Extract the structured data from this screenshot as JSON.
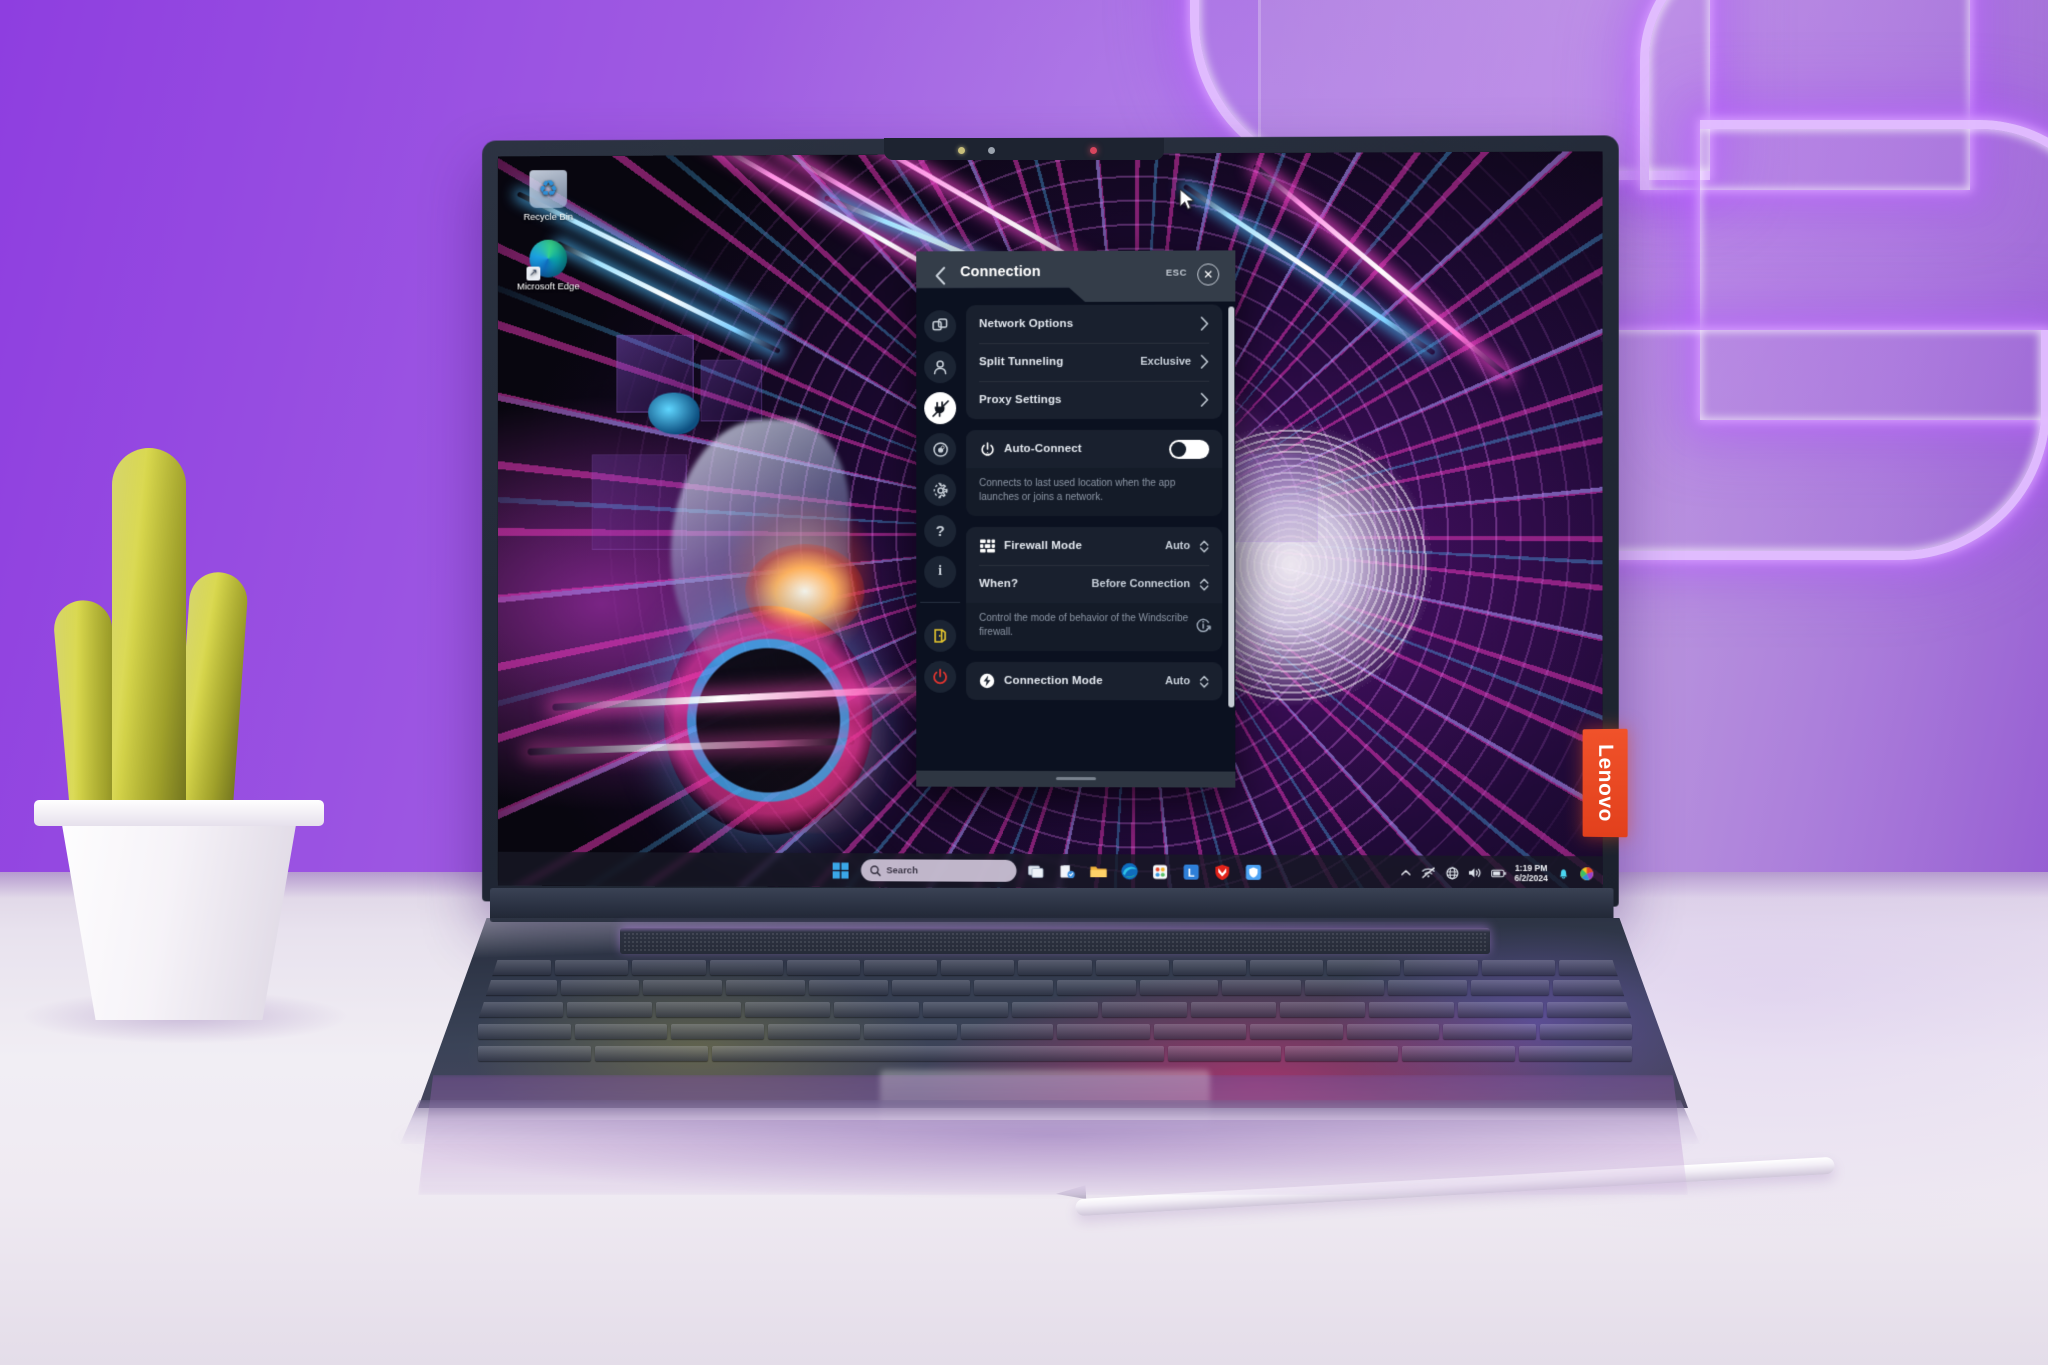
{
  "scene": {
    "description": "Lenovo Yoga laptop on a white desk in front of a purple neon-lit wall, displaying the Windscribe VPN Connection settings panel over a neon motorcycle wallpaper",
    "wall_color": "#9a4fe2",
    "desk_color": "#efeaf2",
    "neon_color": "#e2beff"
  },
  "laptop": {
    "brand_label": "Lenovo",
    "brand_color": "#f0522a"
  },
  "desktop": {
    "icons": [
      {
        "label": "Recycle Bin",
        "icon": "recycle-bin-icon"
      },
      {
        "label": "Microsoft Edge",
        "icon": "microsoft-edge-icon"
      }
    ]
  },
  "app": {
    "header": {
      "back_icon": "chevron-left-icon",
      "title": "Connection",
      "esc_label": "ESC",
      "close_icon": "close-icon"
    },
    "sidebar": [
      {
        "name": "general",
        "icon": "windows-squares-icon",
        "active": false
      },
      {
        "name": "account",
        "icon": "person-icon",
        "active": false
      },
      {
        "name": "connection",
        "icon": "plug-icon",
        "active": true
      },
      {
        "name": "robert",
        "icon": "robert-eye-icon",
        "active": false
      },
      {
        "name": "preferences",
        "icon": "gear-icon",
        "active": false
      },
      {
        "name": "help",
        "icon": "question-mark-icon",
        "active": false
      },
      {
        "name": "about",
        "icon": "info-icon",
        "active": false
      },
      {
        "name": "logout",
        "icon": "door-exit-icon",
        "active": false
      },
      {
        "name": "quit",
        "icon": "power-icon",
        "active": false
      }
    ],
    "sections": [
      {
        "name": "navigation-card",
        "rows": [
          {
            "label": "Network Options",
            "value": "",
            "control": "chevron-right-icon"
          },
          {
            "label": "Split Tunneling",
            "value": "Exclusive",
            "control": "chevron-right-icon"
          },
          {
            "label": "Proxy Settings",
            "value": "",
            "control": "chevron-right-icon"
          }
        ]
      },
      {
        "name": "auto-connect-card",
        "icon": "power-auto-icon",
        "label": "Auto-Connect",
        "toggle_state": "off",
        "description": "Connects to last used location when the app launches or joins a network."
      },
      {
        "name": "firewall-mode-card",
        "icon": "firewall-bricks-icon",
        "label": "Firewall Mode",
        "value": "Auto",
        "when_label": "When?",
        "when_value": "Before Connection",
        "description": "Control the mode of behavior of the Windscribe firewall.",
        "info_icon": "info-external-link-icon"
      },
      {
        "name": "connection-mode-card",
        "icon": "lightning-bolt-icon",
        "label": "Connection Mode",
        "value": "Auto"
      }
    ]
  },
  "taskbar": {
    "start_icon": "windows-start-icon",
    "search": {
      "placeholder": "Search",
      "value": "",
      "icon": "search-icon"
    },
    "apps": [
      {
        "name": "task-view",
        "icon": "task-view-icon"
      },
      {
        "name": "microsoft-store",
        "icon": "store-icon"
      },
      {
        "name": "file-explorer",
        "icon": "folder-icon"
      },
      {
        "name": "microsoft-edge",
        "icon": "edge-icon"
      },
      {
        "name": "photos",
        "icon": "photos-icon"
      },
      {
        "name": "lenovo-vantage",
        "icon": "lenovo-l-icon"
      },
      {
        "name": "mcafee",
        "icon": "mcafee-shield-icon"
      },
      {
        "name": "windscribe",
        "icon": "windscribe-icon"
      }
    ],
    "tray": [
      {
        "name": "show-hidden-icons",
        "icon": "chevron-up-icon"
      },
      {
        "name": "network",
        "icon": "network-off-icon"
      },
      {
        "name": "vpn",
        "icon": "globe-icon"
      },
      {
        "name": "volume",
        "icon": "speaker-icon"
      },
      {
        "name": "battery",
        "icon": "battery-icon"
      }
    ],
    "clock": {
      "time": "1:19 PM",
      "date": "6/2/2024"
    },
    "tray_extra": [
      {
        "name": "notifications",
        "icon": "bell-icon"
      },
      {
        "name": "color-profile",
        "icon": "color-wheel-icon"
      }
    ]
  }
}
